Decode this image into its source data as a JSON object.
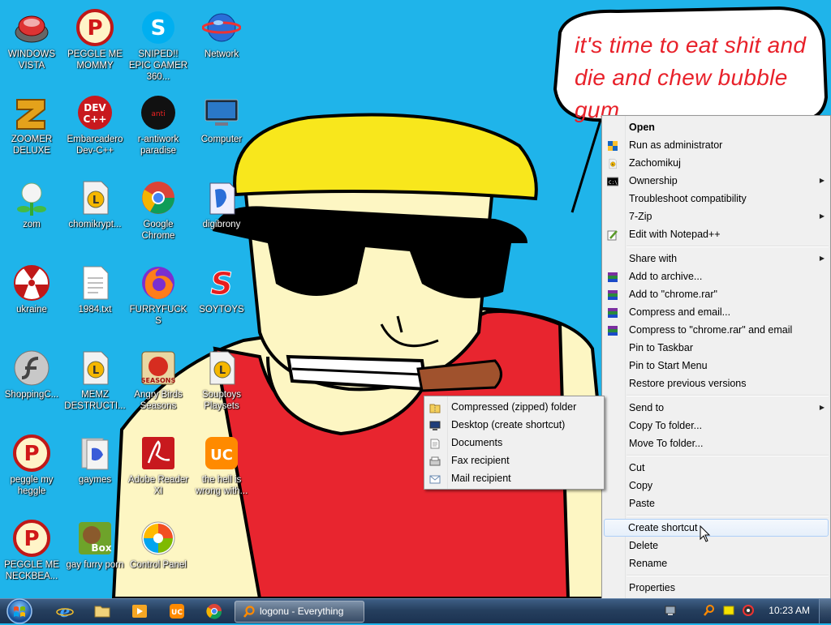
{
  "desktop": {
    "bubble_text": "it's time to eat shit and die and chew bubble gum",
    "icons": [
      {
        "label": "WINDOWS VISTA",
        "icon": "vista-orb-icon"
      },
      {
        "label": "PEGGLE ME MOMMY",
        "icon": "peggle-icon"
      },
      {
        "label": "SNIPED!! EPIC GAMER 360...",
        "icon": "skype-icon"
      },
      {
        "label": "Network",
        "icon": "network-icon"
      },
      {
        "label": "ZOOMER DELUXE",
        "icon": "zuma-icon"
      },
      {
        "label": "Embarcadero Dev-C++",
        "icon": "devcpp-icon"
      },
      {
        "label": "r-antiwork paradise",
        "icon": "antiwork-icon"
      },
      {
        "label": "Computer",
        "icon": "computer-icon"
      },
      {
        "label": "zom",
        "icon": "zombie-plant-icon"
      },
      {
        "label": "chomikrypt...",
        "icon": "chomikuj-icon"
      },
      {
        "label": "Google Chrome",
        "icon": "chrome-icon"
      },
      {
        "label": "digibrony",
        "icon": "digibrony-icon"
      },
      {
        "label": "ukraine",
        "icon": "radiation-icon"
      },
      {
        "label": "1984.txt",
        "icon": "text-file-icon"
      },
      {
        "label": "FURRYFUCKS",
        "icon": "firefox-icon"
      },
      {
        "label": "SOYTOYS",
        "icon": "soytoys-icon"
      },
      {
        "label": "ShoppingC...",
        "icon": "flash-icon"
      },
      {
        "label": "MEMZ DESTRUCTI...",
        "icon": "memz-icon"
      },
      {
        "label": "Angry Birds Seasons",
        "icon": "angry-birds-icon"
      },
      {
        "label": "Souptoys Playsets",
        "icon": "souptoys-icon"
      },
      {
        "label": "peggle my heggle",
        "icon": "peggle-icon"
      },
      {
        "label": "gaymes",
        "icon": "games-folder-icon"
      },
      {
        "label": "Adobe Reader XI",
        "icon": "adobe-reader-icon"
      },
      {
        "label": "the hell is wrong with...",
        "icon": "uc-browser-icon"
      },
      {
        "label": "PEGGLE ME NECKBEA...",
        "icon": "peggle-icon"
      },
      {
        "label": "gay furry porn",
        "icon": "box-beaver-icon"
      },
      {
        "label": "Control Panel",
        "icon": "control-panel-icon"
      }
    ]
  },
  "context_menu": {
    "items": [
      {
        "label": "Open",
        "bold": true
      },
      {
        "label": "Run as administrator",
        "icon": "shield-icon"
      },
      {
        "label": "Zachomikuj",
        "icon": "chomikuj-icon"
      },
      {
        "label": "Ownership",
        "icon": "cmd-icon",
        "submenu": true
      },
      {
        "label": "Troubleshoot compatibility"
      },
      {
        "label": "7-Zip",
        "submenu": true
      },
      {
        "label": "Edit with Notepad++",
        "icon": "notepadpp-icon"
      },
      {
        "separator": true
      },
      {
        "label": "Share with",
        "submenu": true
      },
      {
        "label": "Add to archive...",
        "icon": "winrar-icon"
      },
      {
        "label": "Add to \"chrome.rar\"",
        "icon": "winrar-icon"
      },
      {
        "label": "Compress and email...",
        "icon": "winrar-icon"
      },
      {
        "label": "Compress to \"chrome.rar\" and email",
        "icon": "winrar-icon"
      },
      {
        "label": "Pin to Taskbar"
      },
      {
        "label": "Pin to Start Menu"
      },
      {
        "label": "Restore previous versions"
      },
      {
        "separator": true
      },
      {
        "label": "Send to",
        "submenu": true
      },
      {
        "label": "Copy To folder..."
      },
      {
        "label": "Move To folder..."
      },
      {
        "separator": true
      },
      {
        "label": "Cut"
      },
      {
        "label": "Copy"
      },
      {
        "label": "Paste"
      },
      {
        "separator": true
      },
      {
        "label": "Create shortcut",
        "hover": true
      },
      {
        "label": "Delete"
      },
      {
        "label": "Rename"
      },
      {
        "separator": true
      },
      {
        "label": "Properties"
      }
    ]
  },
  "send_to_menu": {
    "items": [
      {
        "label": "Compressed (zipped) folder",
        "icon": "zip-folder-icon"
      },
      {
        "label": "Desktop (create shortcut)",
        "icon": "desktop-icon"
      },
      {
        "label": "Documents",
        "icon": "documents-icon"
      },
      {
        "label": "Fax recipient",
        "icon": "fax-icon"
      },
      {
        "label": "Mail recipient",
        "icon": "mail-icon"
      }
    ]
  },
  "taskbar": {
    "active_task_label": "logonu - Everything",
    "pinned": [
      "internet-explorer-icon",
      "explorer-folder-icon",
      "media-player-icon",
      "uc-browser-icon",
      "chrome-icon"
    ],
    "tray_icons": [
      "network-tray-icon",
      "search-tray-icon",
      "notification-tray-icon",
      "volume-tray-icon"
    ],
    "clock": "10:23 AM"
  }
}
